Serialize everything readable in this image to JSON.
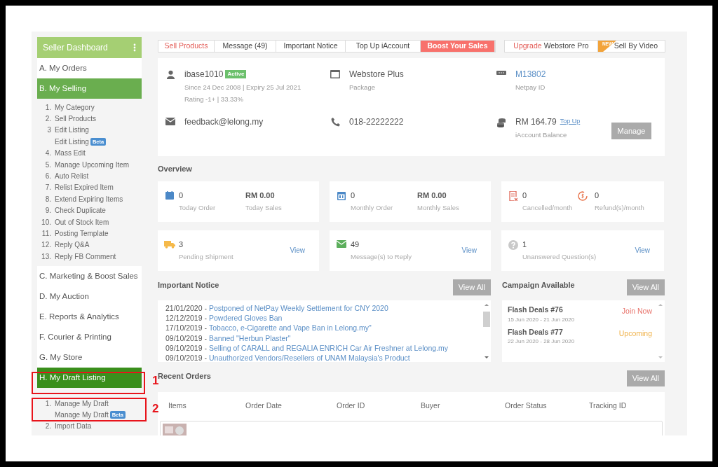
{
  "sidebar": {
    "title": "Seller Dashboard",
    "sections": [
      {
        "label": "A. My Orders",
        "expanded": false,
        "selected": false
      },
      {
        "label": "B. My Selling",
        "expanded": true,
        "selected": false,
        "children": [
          {
            "number": "1.",
            "label": "My Category"
          },
          {
            "number": "2.",
            "label": "Sell Products"
          },
          {
            "number": "3",
            "label": "Edit Listing"
          },
          {
            "label": "Edit Listing",
            "badge": "Beta"
          },
          {
            "number": "4.",
            "label": "Mass Edit"
          },
          {
            "number": "5.",
            "label": "Manage Upcoming Item"
          },
          {
            "number": "6.",
            "label": "Auto Relist"
          },
          {
            "number": "7.",
            "label": "Relist Expired Item"
          },
          {
            "number": "8.",
            "label": "Extend Expiring Items"
          },
          {
            "number": "9.",
            "label": "Check Duplicate"
          },
          {
            "number": "10.",
            "label": "Out of Stock Item"
          },
          {
            "number": "11.",
            "label": "Posting Template"
          },
          {
            "number": "12.",
            "label": "Reply Q&A"
          },
          {
            "number": "13.",
            "label": "Reply FB Comment"
          }
        ]
      },
      {
        "label": "C. Marketing & Boost Sales",
        "expanded": false,
        "selected": false
      },
      {
        "label": "D. My Auction",
        "expanded": false,
        "selected": false
      },
      {
        "label": "E. Reports & Analytics",
        "expanded": false,
        "selected": false
      },
      {
        "label": "F. Courier & Printing",
        "expanded": false,
        "selected": false
      },
      {
        "label": "G. My Store",
        "expanded": false,
        "selected": false
      },
      {
        "label": "H. My Draft Listing",
        "expanded": true,
        "selected": true,
        "children": [
          {
            "number": "1.",
            "label": "Manage My Draft"
          },
          {
            "label": "Manage My Draft",
            "badge": "Beta"
          },
          {
            "number": "2.",
            "label": "Import Data"
          }
        ]
      }
    ]
  },
  "tabs": [
    {
      "label": "Sell Products",
      "kind": "link"
    },
    {
      "label": "Message (49)",
      "kind": "plain"
    },
    {
      "label": "Important Notice",
      "kind": "plain"
    },
    {
      "label": "Top Up iAccount",
      "kind": "plain"
    },
    {
      "label": "Boost Your Sales",
      "kind": "highlight"
    }
  ],
  "upgrade": {
    "prefix": "Upgrade",
    "label": "Webstore Pro"
  },
  "video": {
    "ribbon": "NEW",
    "label": "Sell By Video"
  },
  "account": [
    {
      "value": "ibase1010",
      "badge": "Active",
      "lines": [
        "Since 24 Dec 2008 | Expiry 25 Jul 2021",
        "Rating -1+ | 33.33%"
      ]
    },
    {
      "value": "Webstore Plus",
      "lines": [
        "Package"
      ]
    },
    {
      "value": "M13802",
      "link": true,
      "lines": [
        "Netpay ID"
      ]
    },
    {
      "value": "feedback@lelong.my"
    },
    {
      "value": "018-22222222"
    },
    {
      "value": "RM 164.79",
      "action": "Top Up",
      "lines": [
        "iAccount Balance"
      ],
      "button": "Manage"
    }
  ],
  "overview": {
    "title": "Overview",
    "cards": [
      {
        "stats": [
          {
            "value": "0",
            "label": "Today Order"
          },
          {
            "value": "RM 0.00",
            "label": "Today Sales"
          }
        ]
      },
      {
        "stats": [
          {
            "value": "0",
            "label": "Monthly Order"
          },
          {
            "value": "RM 0.00",
            "label": "Monthly Sales"
          }
        ]
      },
      {
        "stats": [
          {
            "value": "0",
            "label": "Cancelled/month"
          },
          {
            "value": "0",
            "label": "Refund(s)/month"
          }
        ]
      },
      {
        "stats": [
          {
            "value": "3",
            "label": "Pending Shipment"
          }
        ],
        "action": "View"
      },
      {
        "stats": [
          {
            "value": "49",
            "label": "Message(s) to Reply"
          }
        ],
        "action": "View"
      },
      {
        "stats": [
          {
            "value": "1",
            "label": "Unanswered Question(s)"
          }
        ],
        "action": "View"
      }
    ]
  },
  "notice": {
    "title": "Important Notice",
    "button": "View All",
    "items": [
      {
        "date": "21/01/2020 -",
        "title": "Postponed of NetPay Weekly Settlement for CNY 2020"
      },
      {
        "date": "12/12/2019 -",
        "title": "Powdered Gloves Ban"
      },
      {
        "date": "17/10/2019 -",
        "title": "Tobacco, e-Cigarette and Vape Ban in Lelong.my\""
      },
      {
        "date": "09/10/2019 -",
        "title": "Banned \"Herbun Plaster\""
      },
      {
        "date": "09/10/2019 -",
        "title": "Selling of CARALL and REGALIA ENRICH Car Air Freshner at Lelong.my"
      },
      {
        "date": "09/10/2019 -",
        "title": "Unauthorized Vendors/Resellers of UNAM Malaysia's Product"
      }
    ]
  },
  "campaign": {
    "title": "Campaign Available",
    "button": "View All",
    "items": [
      {
        "name": "Flash Deals #76",
        "dates": "15 Jun 2020 - 21 Jun 2020",
        "status": "Join Now",
        "color": "#e8736b"
      },
      {
        "name": "Flash Deals #77",
        "dates": "22 Jun 2020 - 28 Jun 2020",
        "status": "Upcoming",
        "color": "#f0b24a"
      }
    ]
  },
  "orders": {
    "title": "Recent Orders",
    "button": "View All",
    "columns": [
      "Items",
      "Order Date",
      "Order ID",
      "Buyer",
      "Order Status",
      "Tracking ID"
    ]
  },
  "annotations": [
    {
      "label": "1"
    },
    {
      "label": "2"
    }
  ]
}
